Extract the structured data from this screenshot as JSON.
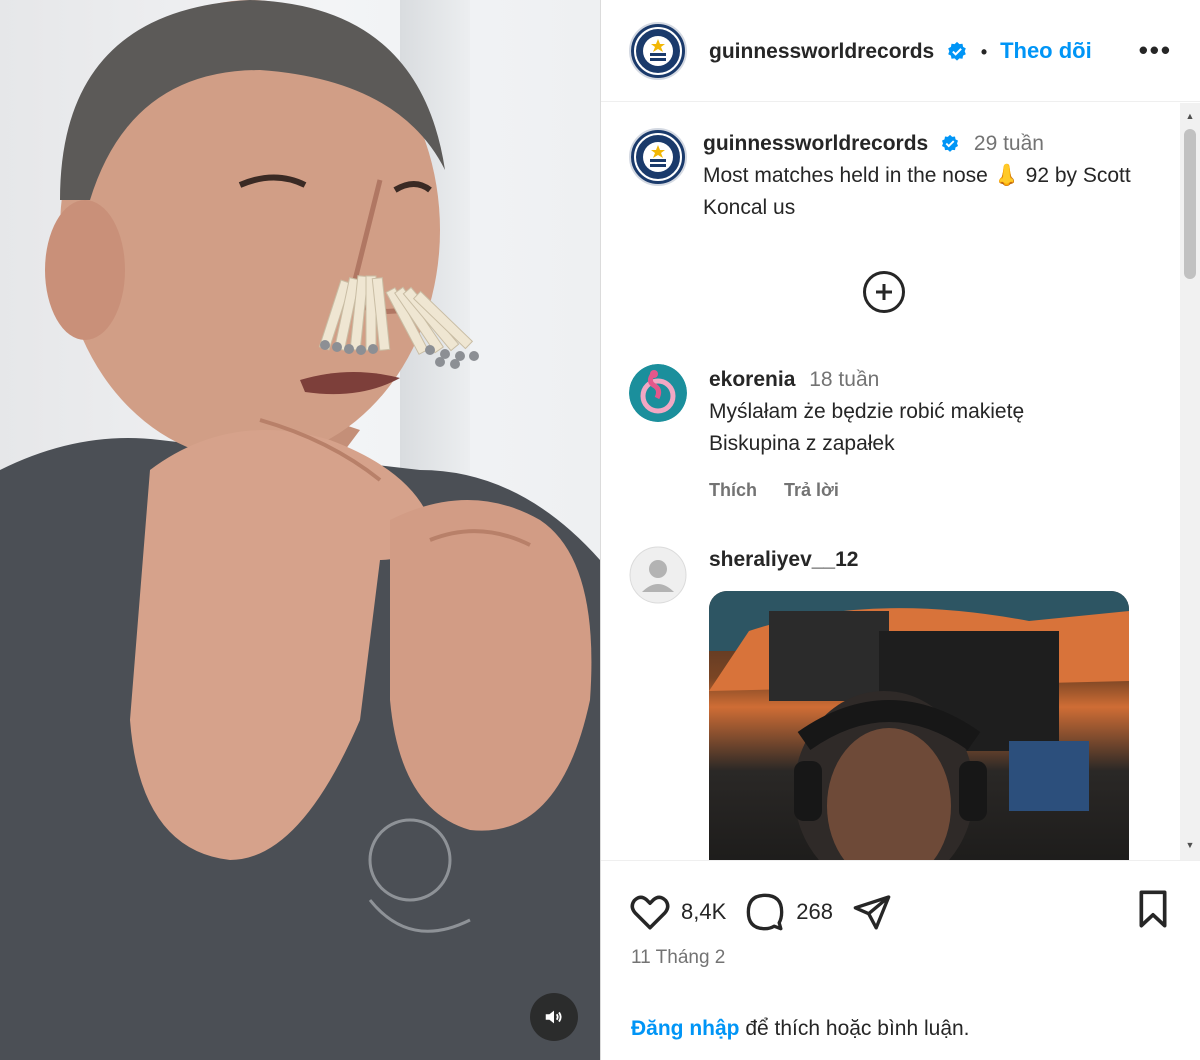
{
  "header": {
    "username": "guinnessworldrecords",
    "separator": "•",
    "follow_label": "Theo dõi",
    "more_label": "•••"
  },
  "caption": {
    "username": "guinnessworldrecords",
    "time": "29 tuần",
    "text": "Most matches held in the nose 👃 92 by Scott Koncal us"
  },
  "comments": [
    {
      "username": "ekorenia",
      "time": "18 tuần",
      "text": "Myślałam że będzie robić makietę Biskupina z zapałek",
      "like_label": "Thích",
      "reply_label": "Trả lời"
    },
    {
      "username": "sheraliyev__12"
    }
  ],
  "footer": {
    "likes": "8,4K",
    "comments": "268",
    "date": "11 Tháng 2",
    "login_link": "Đăng nhập",
    "login_rest": " để thích hoặc bình luận."
  },
  "colors": {
    "accent": "#0095f6",
    "text": "#262626",
    "muted": "#737373"
  },
  "icons": {
    "like": "heart-icon",
    "comment": "comment-icon",
    "share": "share-icon",
    "save": "bookmark-icon",
    "more_comments": "plus-circle-icon",
    "mute": "speaker-icon"
  }
}
